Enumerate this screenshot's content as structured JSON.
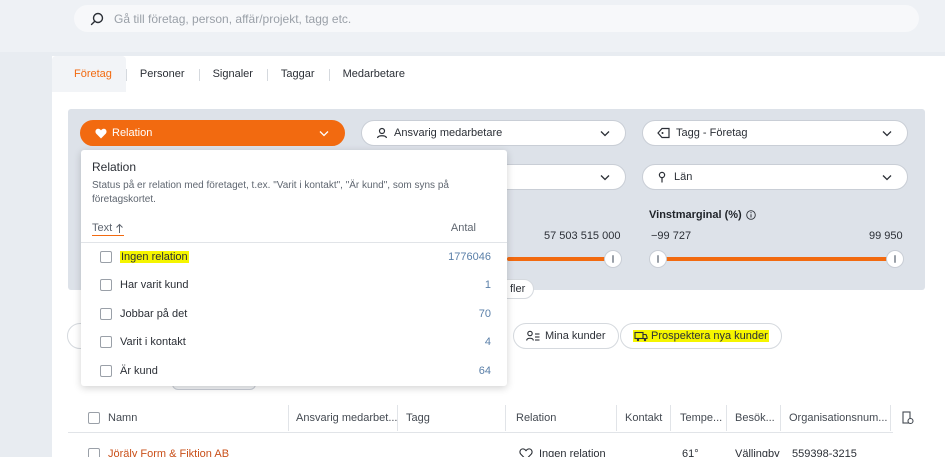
{
  "search": {
    "placeholder": "Gå till företag, person, affär/projekt, tagg etc."
  },
  "tabs": [
    {
      "label": "Företag",
      "active": true
    },
    {
      "label": "Personer",
      "active": false
    },
    {
      "label": "Signaler",
      "active": false
    },
    {
      "label": "Taggar",
      "active": false
    },
    {
      "label": "Medarbetare",
      "active": false
    }
  ],
  "filters": {
    "relation_label": "Relation",
    "ansvarig_label": "Ansvarig medarbetare",
    "tagg_label": "Tagg - Företag",
    "lan_label": "Län",
    "range_value": "57 503 515 000",
    "vinstmarginal": {
      "label": "Vinstmarginal (%)",
      "min_label": "−99 727",
      "max_label": "99 950"
    },
    "more_label": "fler"
  },
  "pills": {
    "mina_kunder": "Mina kunder",
    "prospektera": "Prospektera nya kunder"
  },
  "popover": {
    "title": "Relation",
    "description": "Status på er relation med företaget, t.ex. \"Varit i kontakt\", \"Är kund\", som syns på företagskortet.",
    "col_text": "Text",
    "col_antal": "Antal",
    "options": [
      {
        "label": "Ingen relation",
        "count": "1776046",
        "highlighted": true
      },
      {
        "label": "Har varit kund",
        "count": "1",
        "highlighted": false
      },
      {
        "label": "Jobbar på det",
        "count": "70",
        "highlighted": false
      },
      {
        "label": "Varit i kontakt",
        "count": "4",
        "highlighted": false
      },
      {
        "label": "Är kund",
        "count": "64",
        "highlighted": false
      }
    ]
  },
  "table": {
    "headers": {
      "namn": "Namn",
      "ansvarig": "Ansvarig medarbet...",
      "tagg": "Tagg",
      "relation": "Relation",
      "kontakt": "Kontakt",
      "tempe": "Tempe...",
      "besok": "Besök...",
      "org": "Organisationsnum..."
    },
    "first_row": {
      "namn": "Jöräly Form & Fiktion AB",
      "relation": "Ingen relation",
      "tempe": "61°",
      "besok": "Vällingby",
      "org": "559398-3215"
    }
  },
  "colors": {
    "accent": "#f26a10",
    "highlight": "#f5f500"
  }
}
